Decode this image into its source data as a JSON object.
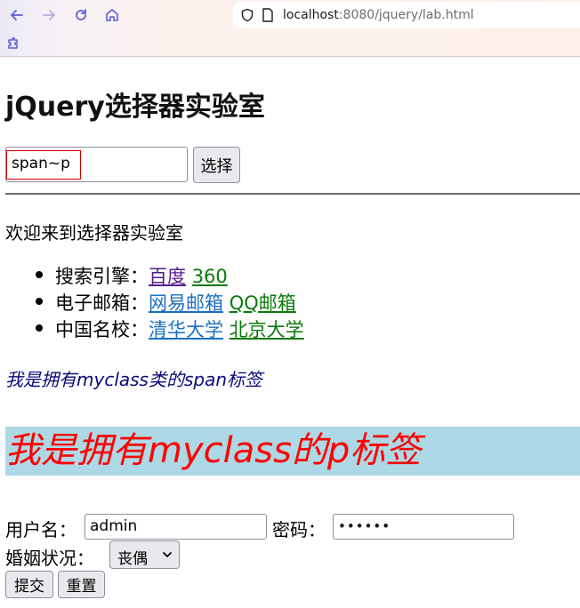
{
  "browser": {
    "url_host": "localhost",
    "url_rest": ":8080/jquery/lab.html",
    "icons": [
      "back-icon",
      "forward-icon",
      "reload-icon",
      "home-icon",
      "shield-icon",
      "page-icon",
      "extension-icon"
    ]
  },
  "page": {
    "title": "jQuery选择器实验室",
    "selector_input_value": "span~p",
    "select_button": "选择",
    "welcome": "欢迎来到选择器实验室",
    "list": [
      {
        "label": "搜索引擎：",
        "links": [
          "百度",
          "360"
        ]
      },
      {
        "label": "电子邮箱：",
        "links": [
          "网易邮箱",
          "QQ邮箱"
        ]
      },
      {
        "label": "中国名校：",
        "links": [
          "清华大学",
          "北京大学"
        ]
      }
    ],
    "span_text": "我是拥有myclass类的span标签",
    "p_text": "我是拥有myclass的p标签"
  },
  "form": {
    "username_label": "用户名：",
    "username_value": "admin",
    "password_label": "密码：",
    "password_value": "••••••",
    "marital_label": "婚姻状况：",
    "marital_selected": "丧偶",
    "submit_label": "提交",
    "reset_label": "重置"
  },
  "colors": {
    "p_background": "#add8e6",
    "p_text": "#ff0000",
    "span_text": "#0a0a7a",
    "visited_link": "#551a8b",
    "blue_link": "#1a6fc4",
    "green_link": "#0a7a0a"
  }
}
